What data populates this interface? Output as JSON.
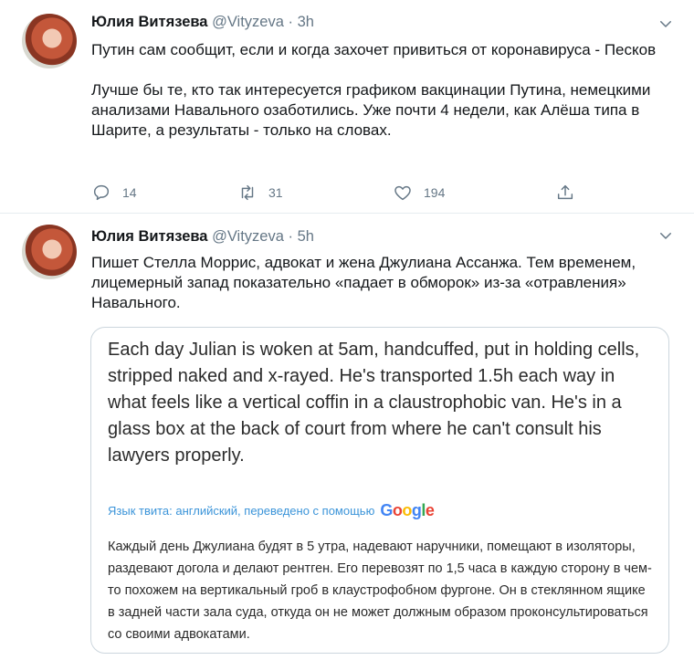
{
  "tweets": [
    {
      "author_name": "Юлия Витязева",
      "handle": "@Vityzeva",
      "separator": "·",
      "time": "3h",
      "text": "Путин сам сообщит, если и когда захочет привиться от коронавируса - Песков\n\nЛучше бы те, кто так интересуется графиком вакцинации Путина, немецкими анализами Навального озаботились. Уже почти 4 недели, как Алёша типа в Шарите, а результаты - только на словах.",
      "replies": "14",
      "retweets": "31",
      "likes": "194"
    },
    {
      "author_name": "Юлия Витязева",
      "handle": "@Vityzeva",
      "separator": "·",
      "time": "5h",
      "text": "Пишет Стелла Моррис, адвокат и жена Джулиана Ассанжа. Тем временем, лицемерный запад показательно «падает в обморок» из-за «отравления» Навального.",
      "quote": {
        "original_text": "Each day Julian is woken at 5am, handcuffed, put in holding cells, stripped naked and x-rayed. He's transported 1.5h each way in what feels like a vertical coffin in a claustrophobic van. He's in a glass box at the back of court from where he can't consult his lawyers properly.",
        "translation_note": "Язык твита: английский, переведено с помощью",
        "translator_brand": "Google",
        "translated_text": "Каждый день Джулиана будят в 5 утра, надевают наручники, помещают в изоляторы, раздевают догола и делают рентген. Его перевозят по 1,5 часа в каждую сторону в чем-то похожем на вертикальный гроб в клаустрофобном фургоне. Он в стеклянном ящике в задней части зала суда, откуда он не может должным образом проконсультироваться со своими адвокатами."
      }
    }
  ],
  "icons": {
    "reply": "reply-icon",
    "retweet": "retweet-icon",
    "like": "heart-icon",
    "share": "share-icon",
    "menu": "chevron-down-icon"
  },
  "colors": {
    "secondary_text": "#657786",
    "link_blue": "#3b94d9",
    "border": "#ccd6dd"
  }
}
